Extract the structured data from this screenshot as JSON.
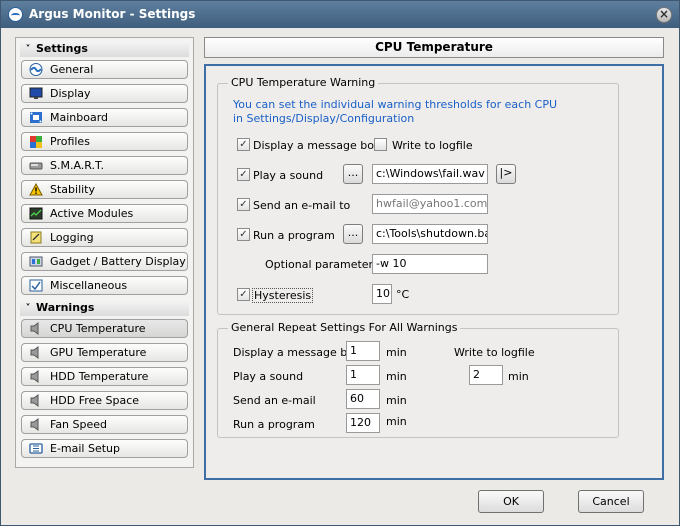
{
  "window": {
    "title": "Argus Monitor - Settings",
    "close_glyph": "×"
  },
  "sidebar": {
    "settings_header": "Settings",
    "settings_items": [
      {
        "label": "General",
        "icon": "argus-icon"
      },
      {
        "label": "Display",
        "icon": "monitor-icon"
      },
      {
        "label": "Mainboard",
        "icon": "mainboard-icon"
      },
      {
        "label": "Profiles",
        "icon": "profiles-icon"
      },
      {
        "label": "S.M.A.R.T.",
        "icon": "harddisk-icon"
      },
      {
        "label": "Stability",
        "icon": "warning-icon"
      },
      {
        "label": "Active Modules",
        "icon": "modules-icon"
      },
      {
        "label": "Logging",
        "icon": "logging-icon"
      },
      {
        "label": "Gadget / Battery Display",
        "icon": "gadget-icon"
      },
      {
        "label": "Miscellaneous",
        "icon": "misc-icon"
      }
    ],
    "warnings_header": "Warnings",
    "warning_items": [
      {
        "label": "CPU Temperature",
        "icon": "speaker-icon"
      },
      {
        "label": "GPU Temperature",
        "icon": "speaker-icon"
      },
      {
        "label": "HDD Temperature",
        "icon": "speaker-icon"
      },
      {
        "label": "HDD Free Space",
        "icon": "speaker-icon"
      },
      {
        "label": "Fan Speed",
        "icon": "speaker-icon"
      },
      {
        "label": "E-mail Setup",
        "icon": "email-setup-icon"
      }
    ]
  },
  "panel": {
    "title": "CPU Temperature",
    "warning_group": {
      "title": "CPU Temperature Warning",
      "info": "You can set the individual warning thresholds for each CPU in Settings/Display/Configuration",
      "display_message_box": {
        "label": "Display a message box",
        "checked": true
      },
      "write_to_logfile": {
        "label": "Write to logfile",
        "checked": false
      },
      "play_sound": {
        "label": "Play a sound",
        "checked": true,
        "browse": "...",
        "value": "c:\\Windows\\fail.wav",
        "play_glyph": "|>"
      },
      "send_email": {
        "label": "Send an e-mail to",
        "checked": true,
        "value": "hwfail@yahoo1.com"
      },
      "run_program": {
        "label": "Run a program",
        "checked": true,
        "browse": "...",
        "value": "c:\\Tools\\shutdown.bat"
      },
      "optional_parameters": {
        "label": "Optional parameters",
        "value": "-w 10"
      },
      "hysteresis": {
        "label": "Hysteresis",
        "checked": true,
        "value": "10",
        "unit": "°C"
      }
    },
    "repeat_group": {
      "title": "General Repeat Settings For All Warnings",
      "rows": [
        {
          "label": "Display a message box",
          "value": "1",
          "unit": "min"
        },
        {
          "label": "Play a sound",
          "value": "1",
          "unit": "min"
        },
        {
          "label": "Send an e-mail",
          "value": "60",
          "unit": "min"
        },
        {
          "label": "Run a program",
          "value": "120",
          "unit": "min"
        }
      ],
      "logfile": {
        "label": "Write to logfile",
        "value": "2",
        "unit": "min"
      }
    }
  },
  "buttons": {
    "ok": "OK",
    "cancel": "Cancel"
  }
}
